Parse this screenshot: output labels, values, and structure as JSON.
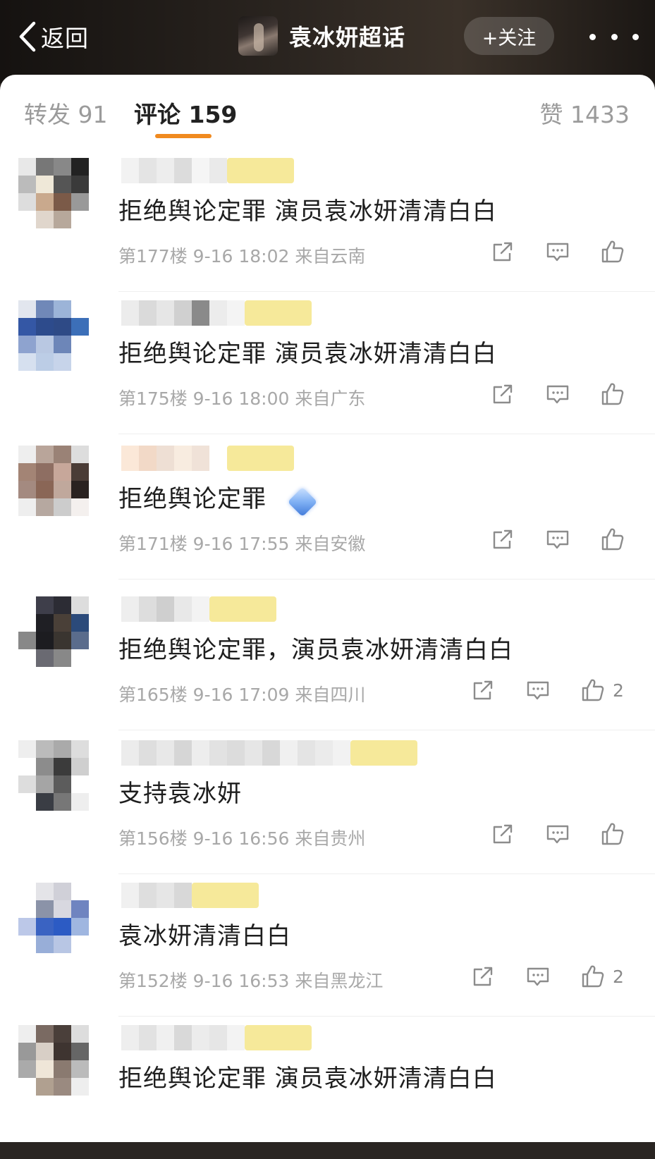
{
  "header": {
    "back_label": "返回",
    "topic_title": "袁冰妍超话",
    "follow_label": "+关注"
  },
  "tabs": {
    "forward": "转发 91",
    "comments": "评论 159",
    "likes": "赞 1433",
    "active": "comments",
    "indicator_color": "#f08a1f"
  },
  "comments": [
    {
      "text": "拒绝舆论定罪  演员袁冰妍清清白白",
      "meta": "第177楼 9-16 18:02 来自云南",
      "likes": ""
    },
    {
      "text": "拒绝舆论定罪  演员袁冰妍清清白白",
      "meta": "第175楼 9-16 18:00 来自广东",
      "likes": ""
    },
    {
      "text": "拒绝舆论定罪",
      "meta": "第171楼 9-16 17:55 来自安徽",
      "likes": "",
      "emoji": "diamond-emoji"
    },
    {
      "text": "拒绝舆论定罪，演员袁冰妍清清白白",
      "meta": "第165楼 9-16 17:09 来自四川",
      "likes": "2"
    },
    {
      "text": "支持袁冰妍",
      "meta": "第156楼 9-16 16:56 来自贵州",
      "likes": ""
    },
    {
      "text": "袁冰妍清清白白",
      "meta": "第152楼 9-16 16:53 来自黑龙江",
      "likes": "2"
    },
    {
      "text": "拒绝舆论定罪  演员袁冰妍清清白白",
      "meta": "",
      "likes": ""
    }
  ],
  "icons": {
    "back": "chevron-left-icon",
    "more": "more-dots-icon",
    "repost": "repost-icon",
    "reply": "comment-icon",
    "like": "thumbs-up-icon"
  },
  "colors": {
    "accent": "#f08a1f",
    "vip_badge": "#f6e99a",
    "meta_text": "#a8a8a8"
  }
}
